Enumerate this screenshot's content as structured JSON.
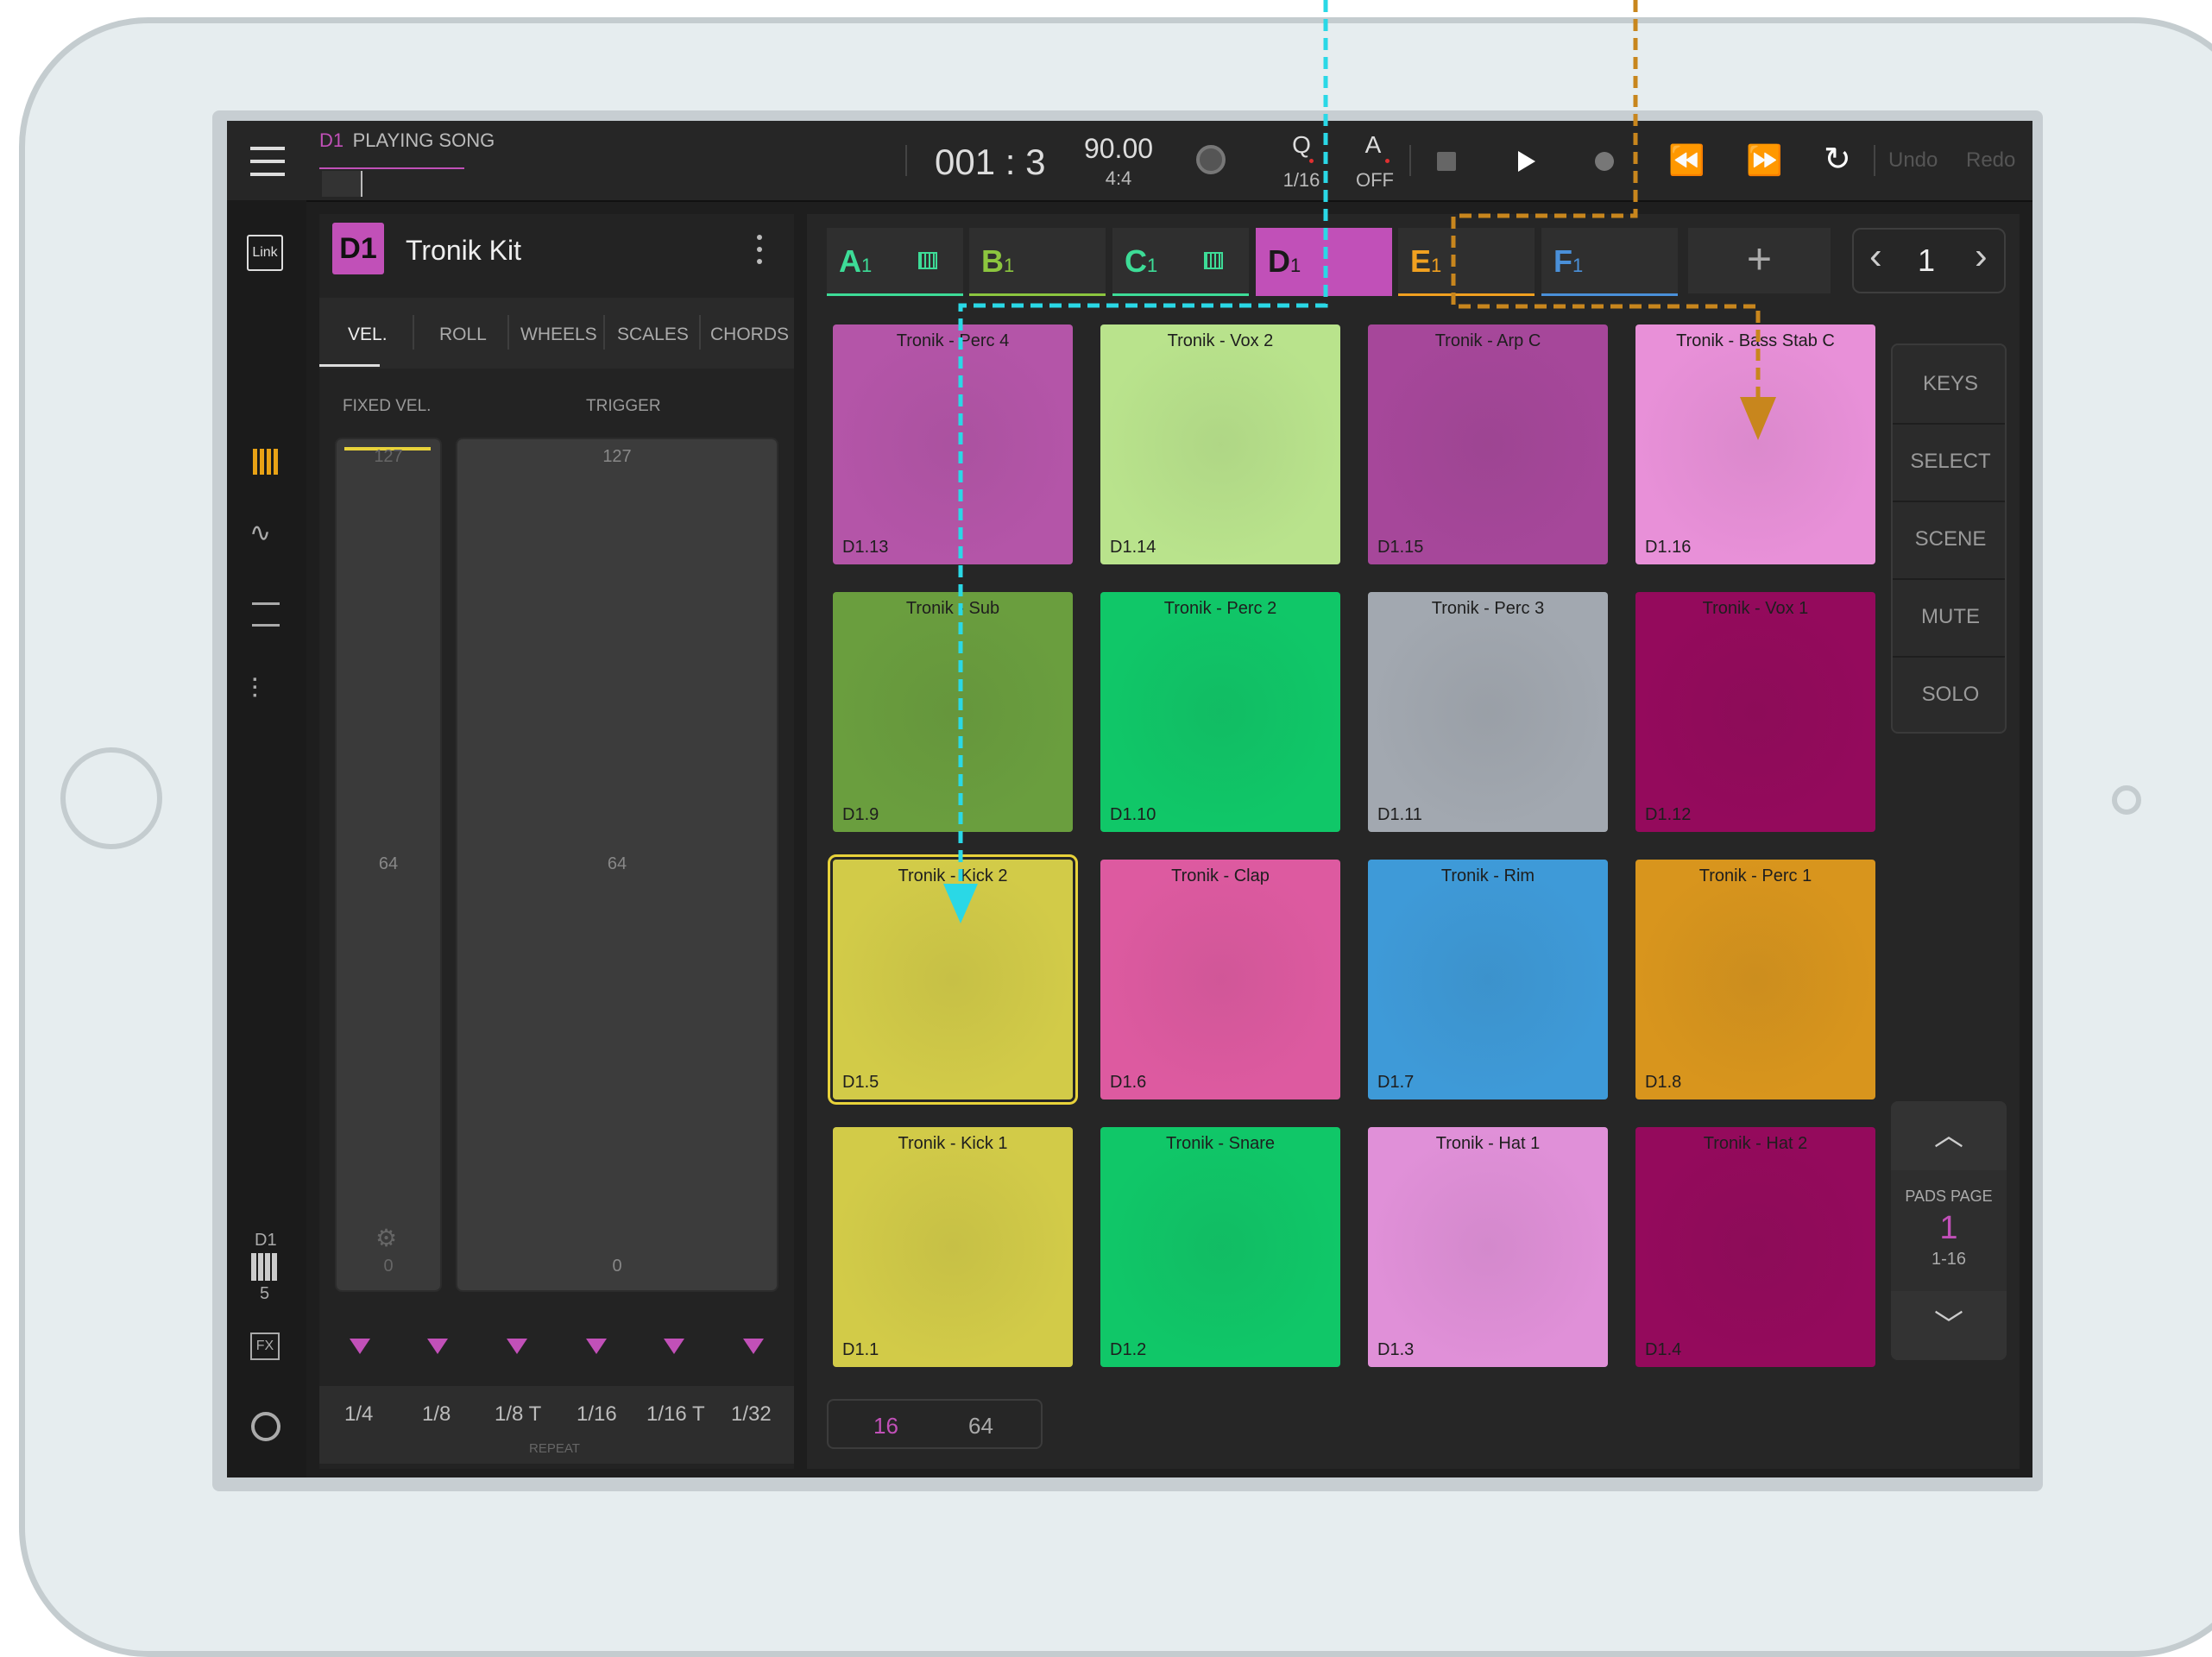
{
  "topbar": {
    "track_id": "D1",
    "status": "PLAYING SONG",
    "position": "001 : 3",
    "tempo": "90.00",
    "time_sig": "4:4",
    "quantize_label": "Q",
    "quantize_value": "1/16",
    "auto_label": "A",
    "auto_value": "OFF",
    "undo": "Undo",
    "redo": "Redo"
  },
  "sidebar": {
    "link": "Link",
    "track_label": "D1",
    "track_number": "5",
    "fx": "FX"
  },
  "instrument": {
    "badge": "D1",
    "name": "Tronik Kit",
    "tabs": [
      "VEL.",
      "ROLL",
      "WHEELS",
      "SCALES",
      "CHORDS"
    ],
    "fixed_vel_label": "FIXED VEL.",
    "trigger_label": "TRIGGER",
    "fixed_top": "127",
    "fixed_mid": "64",
    "fixed_bottom": "0",
    "trigger_top": "127",
    "trigger_mid": "64",
    "trigger_bottom": "0",
    "repeat_values": [
      "1/4",
      "1/8",
      "1/8 T",
      "1/16",
      "1/16 T",
      "1/32"
    ],
    "repeat_label": "REPEAT"
  },
  "tracks": [
    {
      "letter": "A",
      "sub": "1",
      "color": "#3ddc97"
    },
    {
      "letter": "B",
      "sub": "1",
      "color": "#8cc63f"
    },
    {
      "letter": "C",
      "sub": "1",
      "color": "#3ddc97"
    },
    {
      "letter": "D",
      "sub": "1",
      "color": "#c150b8"
    },
    {
      "letter": "E",
      "sub": "1",
      "color": "#f0a020"
    },
    {
      "letter": "F",
      "sub": "1",
      "color": "#4a90d9"
    }
  ],
  "page_nav": {
    "value": "1"
  },
  "modes": [
    "KEYS",
    "SELECT",
    "SCENE",
    "MUTE",
    "SOLO"
  ],
  "pads_page": {
    "label": "PADS PAGE",
    "number": "1",
    "range": "1-16"
  },
  "pad_count": {
    "a": "16",
    "b": "64"
  },
  "pads": [
    {
      "name": "Tronik - Perc 4",
      "id": "D1.13",
      "color": "#b455a8"
    },
    {
      "name": "Tronik - Vox 2",
      "id": "D1.14",
      "color": "#b9e38c"
    },
    {
      "name": "Tronik - Arp C",
      "id": "D1.15",
      "color": "#a6479a"
    },
    {
      "name": "Tronik - Bass Stab C",
      "id": "D1.16",
      "color": "#e890d8"
    },
    {
      "name": "Tronik - Sub",
      "id": "D1.9",
      "color": "#6a9e3e"
    },
    {
      "name": "Tronik - Perc 2",
      "id": "D1.10",
      "color": "#10c768"
    },
    {
      "name": "Tronik - Perc 3",
      "id": "D1.11",
      "color": "#a2a8b0"
    },
    {
      "name": "Tronik - Vox 1",
      "id": "D1.12",
      "color": "#940a5c"
    },
    {
      "name": "Tronik - Kick 2",
      "id": "D1.5",
      "color": "#d2cb48"
    },
    {
      "name": "Tronik - Clap",
      "id": "D1.6",
      "color": "#dd5aa0"
    },
    {
      "name": "Tronik - Rim",
      "id": "D1.7",
      "color": "#3e9ad8"
    },
    {
      "name": "Tronik - Perc 1",
      "id": "D1.8",
      "color": "#d8951d"
    },
    {
      "name": "Tronik - Kick 1",
      "id": "D1.1",
      "color": "#d2cb48"
    },
    {
      "name": "Tronik - Snare",
      "id": "D1.2",
      "color": "#10c768"
    },
    {
      "name": "Tronik - Hat 1",
      "id": "D1.3",
      "color": "#e090d8"
    },
    {
      "name": "Tronik - Hat 2",
      "id": "D1.4",
      "color": "#940a5c"
    }
  ]
}
